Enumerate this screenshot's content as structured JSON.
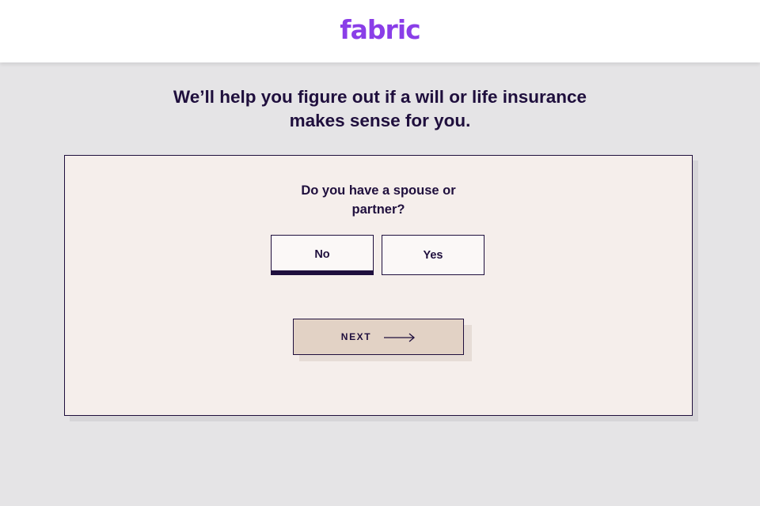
{
  "header": {
    "logo_text": "fabric"
  },
  "intro": {
    "line1": "We’ll help you figure out if a will or life insurance",
    "line2": "makes sense for you."
  },
  "question": {
    "line1": "Do you have a spouse or",
    "line2": "partner?"
  },
  "options": [
    {
      "label": "No",
      "selected": true
    },
    {
      "label": "Yes",
      "selected": false
    }
  ],
  "next_button": {
    "label": "NEXT",
    "icon": "arrow-right-icon"
  },
  "colors": {
    "brand": "#8a3ee8",
    "text": "#1f0f3d",
    "background": "#e5e4e6",
    "card": "#f5eeeb",
    "next_button": "#e2d2c5"
  }
}
